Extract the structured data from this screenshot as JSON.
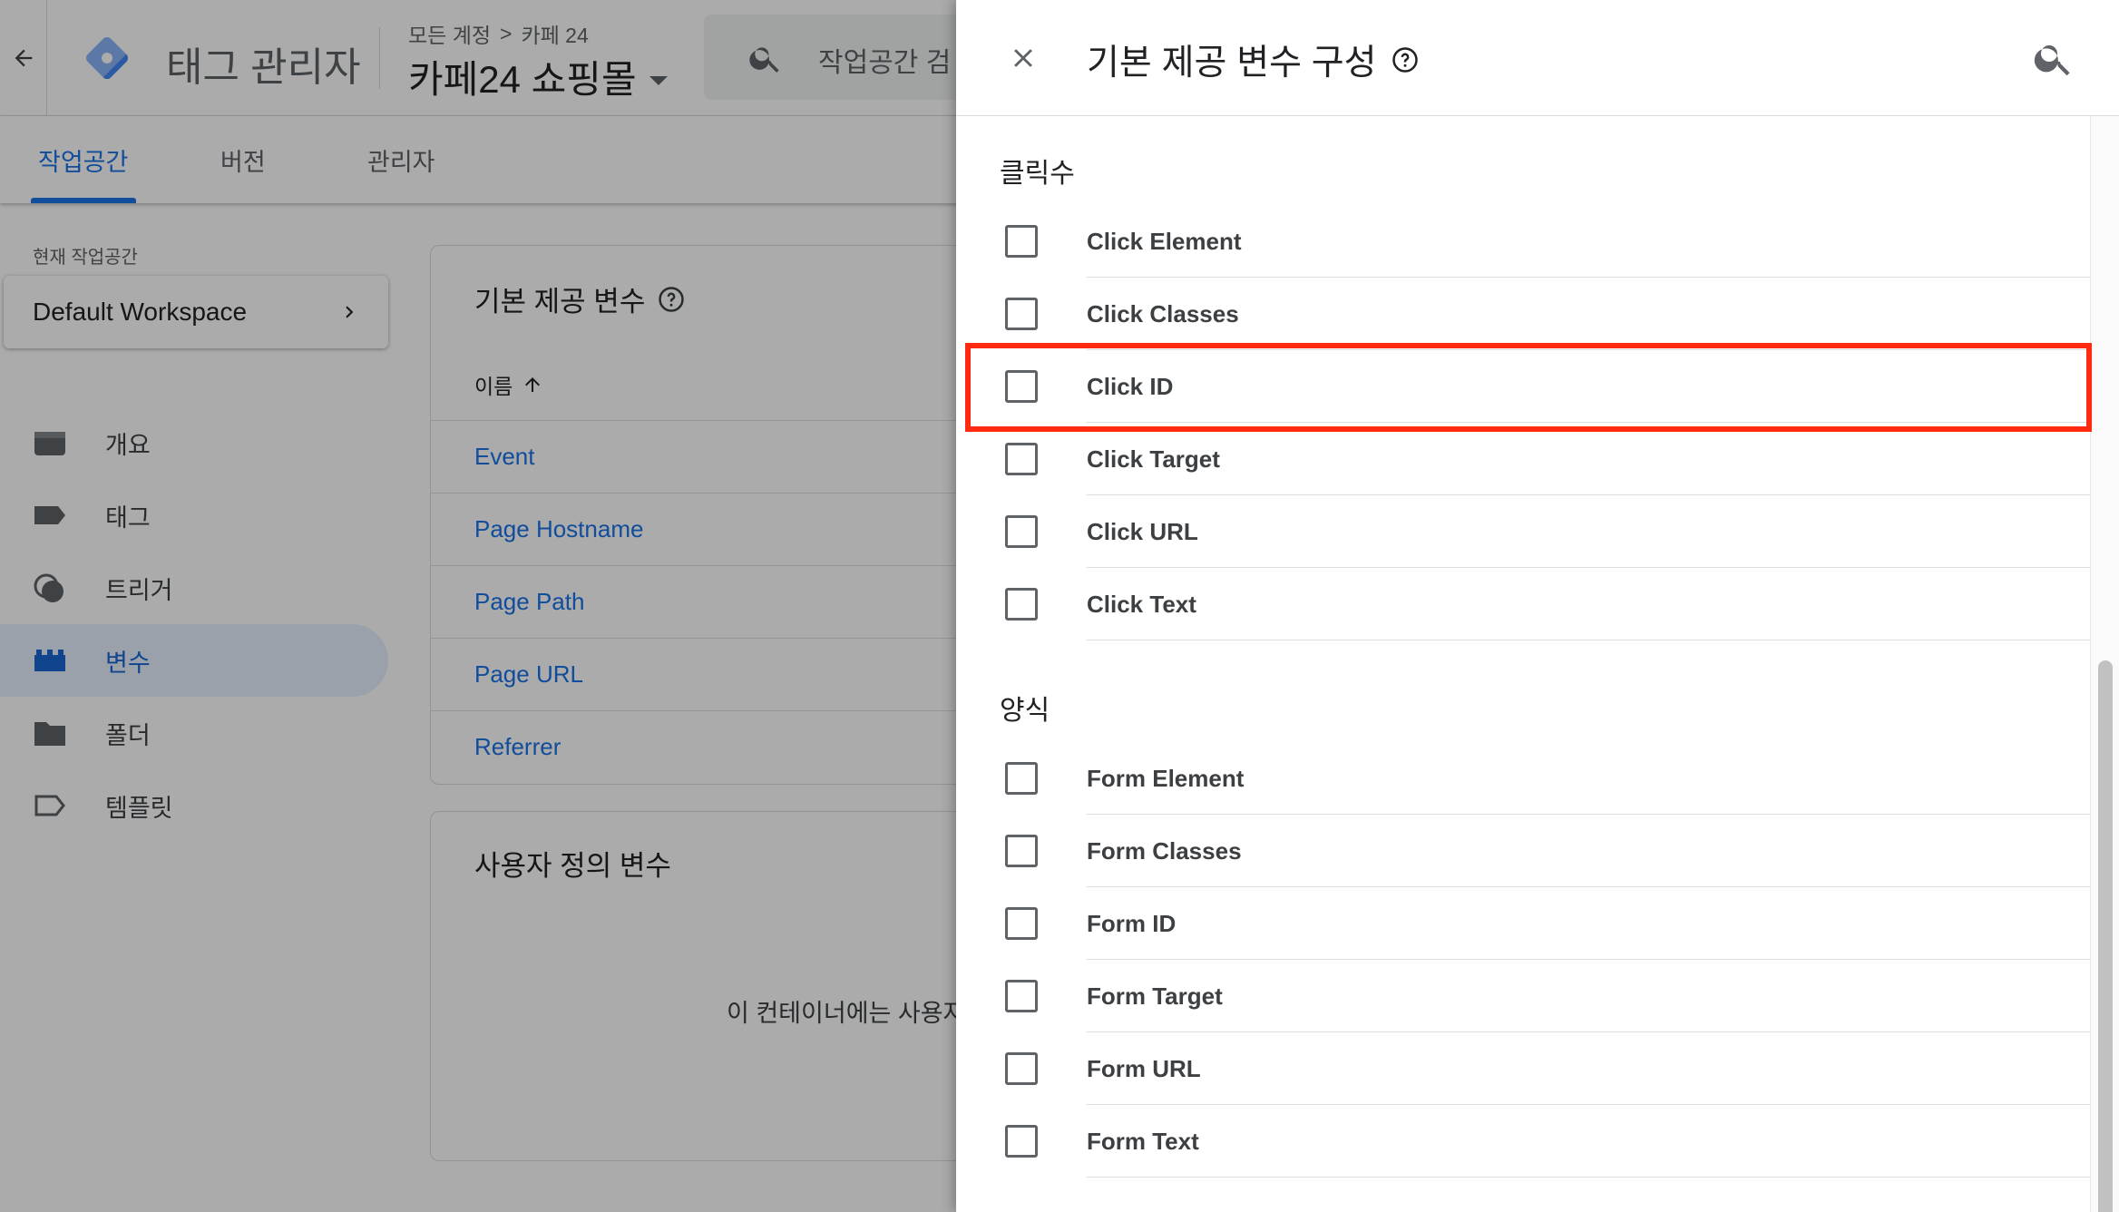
{
  "header": {
    "back_icon": "arrow-back-icon",
    "logo_icon": "tag-manager-logo-icon",
    "app_title": "태그 관리자",
    "breadcrumb": {
      "all_accounts": "모든 계정",
      "separator": ">",
      "account": "카페 24"
    },
    "container_name": "카페24 쇼핑몰",
    "search_placeholder": "작업공간 검"
  },
  "tabs": [
    {
      "label": "작업공간",
      "active": true
    },
    {
      "label": "버전",
      "active": false
    },
    {
      "label": "관리자",
      "active": false
    }
  ],
  "sidebar": {
    "current_workspace_label": "현재 작업공간",
    "workspace_name": "Default Workspace",
    "items": [
      {
        "label": "개요",
        "icon": "overview-icon",
        "active": false
      },
      {
        "label": "태그",
        "icon": "tag-icon",
        "active": false
      },
      {
        "label": "트리거",
        "icon": "trigger-icon",
        "active": false
      },
      {
        "label": "변수",
        "icon": "variables-icon",
        "active": true
      },
      {
        "label": "폴더",
        "icon": "folder-icon",
        "active": false
      },
      {
        "label": "템플릿",
        "icon": "template-icon",
        "active": false
      }
    ]
  },
  "builtin_card": {
    "title": "기본 제공 변수",
    "column_name": "이름",
    "rows": [
      "Event",
      "Page Hostname",
      "Page Path",
      "Page URL",
      "Referrer"
    ]
  },
  "user_card": {
    "title": "사용자 정의 변수",
    "empty_message": "이 컨테이너에는 사용자"
  },
  "panel": {
    "title": "기본 제공 변수 구성",
    "sections": [
      {
        "title": "클릭수",
        "options": [
          {
            "label": "Click Element",
            "checked": false
          },
          {
            "label": "Click Classes",
            "checked": false
          },
          {
            "label": "Click ID",
            "checked": false
          },
          {
            "label": "Click Target",
            "checked": false
          },
          {
            "label": "Click URL",
            "checked": false
          },
          {
            "label": "Click Text",
            "checked": false
          }
        ]
      },
      {
        "title": "양식",
        "options": [
          {
            "label": "Form Element",
            "checked": false
          },
          {
            "label": "Form Classes",
            "checked": false
          },
          {
            "label": "Form ID",
            "checked": false
          },
          {
            "label": "Form Target",
            "checked": false
          },
          {
            "label": "Form URL",
            "checked": false
          },
          {
            "label": "Form Text",
            "checked": false
          }
        ]
      }
    ],
    "highlighted_option": "Click ID"
  },
  "colors": {
    "accent": "#1a73e8",
    "highlight": "#ff2a10",
    "text": "#202124"
  }
}
